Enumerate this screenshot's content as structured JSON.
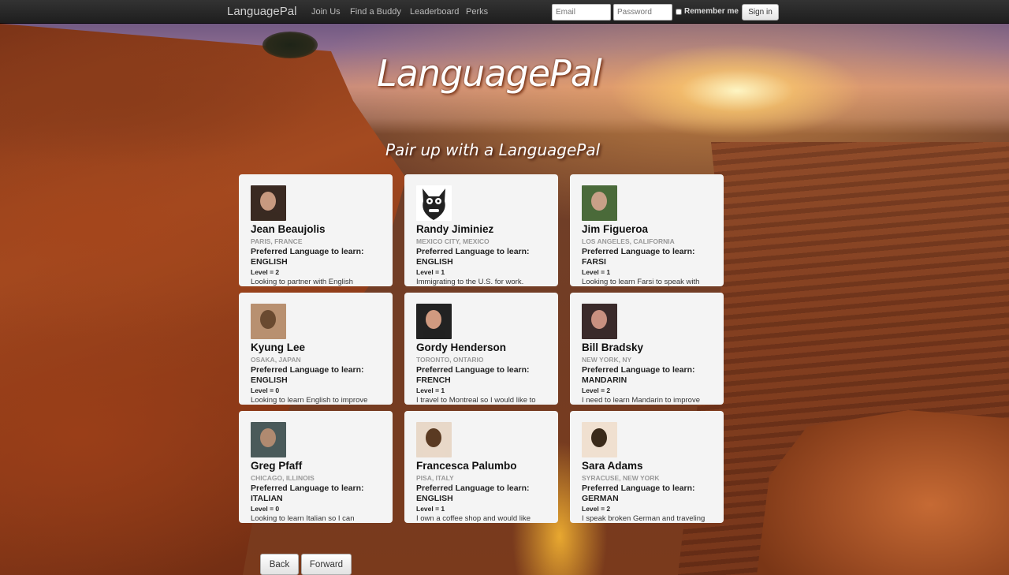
{
  "navbar": {
    "brand": "LanguagePal",
    "links": [
      "Join Us",
      "Find a Buddy",
      "Leaderboard",
      "Perks"
    ],
    "email_placeholder": "Email",
    "password_placeholder": "Password",
    "remember_label": "Remember me",
    "signin_label": "Sign in"
  },
  "hero": {
    "title": "LanguagePal",
    "subtitle": "Pair up with a LanguagePal"
  },
  "profiles": [
    {
      "name": "Jean Beaujolis",
      "location": "PARIS, FRANCE",
      "pref_label": "Preferred Language to learn:",
      "language": "ENGLISH",
      "level": "Level = 2",
      "description": "Looking to partner with English",
      "avatar": "avatar-photo",
      "avatar_colors": [
        "#3a2a22",
        "#c89a80"
      ]
    },
    {
      "name": "Randy Jiminiez",
      "location": "MEXICO CITY, MEXICO",
      "pref_label": "Preferred Language to learn:",
      "language": "ENGLISH",
      "level": "Level = 1",
      "description": "Immigrating to the U.S. for work.",
      "avatar": "cartoon-creature-icon",
      "avatar_colors": [
        "#222",
        "#fff"
      ]
    },
    {
      "name": "Jim Figueroa",
      "location": "LOS ANGELES, CALIFORNIA",
      "pref_label": "Preferred Language to learn:",
      "language": "FARSI",
      "level": "Level = 1",
      "description": "Looking to learn Farsi to speak with",
      "avatar": "avatar-photo",
      "avatar_colors": [
        "#4a6a3a",
        "#c8a088"
      ]
    },
    {
      "name": "Kyung Lee",
      "location": "OSAKA, JAPAN",
      "pref_label": "Preferred Language to learn:",
      "language": "ENGLISH",
      "level": "Level = 0",
      "description": "Looking to learn English to improve",
      "avatar": "avatar-photo",
      "avatar_colors": [
        "#b89070",
        "#6a4a30"
      ]
    },
    {
      "name": "Gordy Henderson",
      "location": "TORONTO, ONTARIO",
      "pref_label": "Preferred Language to learn:",
      "language": "FRENCH",
      "level": "Level = 1",
      "description": "I travel to Montreal so I would like to",
      "avatar": "avatar-photo",
      "avatar_colors": [
        "#222",
        "#d09a80"
      ]
    },
    {
      "name": "Bill Bradsky",
      "location": "NEW YORK, NY",
      "pref_label": "Preferred Language to learn:",
      "language": "MANDARIN",
      "level": "Level = 2",
      "description": "I need to learn Mandarin to improve",
      "avatar": "avatar-photo",
      "avatar_colors": [
        "#3a2a2a",
        "#c89080"
      ]
    },
    {
      "name": "Greg Pfaff",
      "location": "CHICAGO, ILLINOIS",
      "pref_label": "Preferred Language to learn:",
      "language": "ITALIAN",
      "level": "Level = 0",
      "description": "Looking to learn Italian so I can",
      "avatar": "avatar-photo",
      "avatar_colors": [
        "#4a5a5a",
        "#b08a70"
      ]
    },
    {
      "name": "Francesca Palumbo",
      "location": "PISA, ITALY",
      "pref_label": "Preferred Language to learn:",
      "language": "ENGLISH",
      "level": "Level = 1",
      "description": "I own a coffee shop and would like",
      "avatar": "avatar-photo",
      "avatar_colors": [
        "#e8d8c8",
        "#5a3a22"
      ]
    },
    {
      "name": "Sara Adams",
      "location": "SYRACUSE, NEW YORK",
      "pref_label": "Preferred Language to learn:",
      "language": "GERMAN",
      "level": "Level = 2",
      "description": "I speak broken German and traveling",
      "avatar": "avatar-photo",
      "avatar_colors": [
        "#f0e0d0",
        "#3a2a1a"
      ]
    }
  ],
  "pager": {
    "back_label": "Back",
    "forward_label": "Forward"
  }
}
